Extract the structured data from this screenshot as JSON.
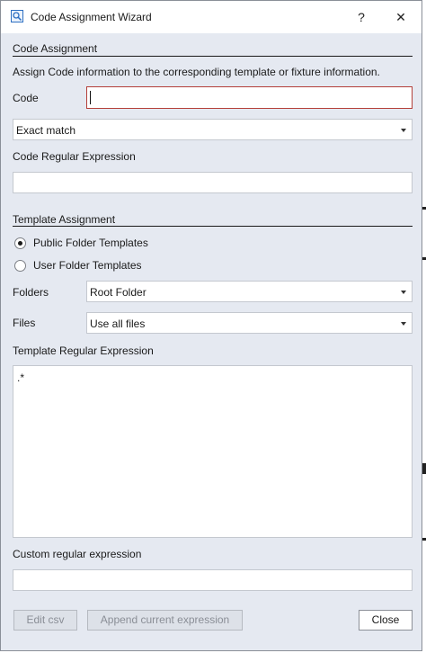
{
  "window": {
    "title": "Code Assignment Wizard",
    "help_label": "?",
    "close_label": "✕"
  },
  "code_assignment": {
    "section_title": "Code Assignment",
    "description": "Assign Code information to the corresponding template or fixture information.",
    "code_label": "Code",
    "code_value": "",
    "match_mode": "Exact match",
    "regex_label": "Code Regular Expression",
    "regex_value": ""
  },
  "template_assignment": {
    "section_title": "Template Assignment",
    "radio_public": "Public Folder Templates",
    "radio_user": "User Folder Templates",
    "selected": "public",
    "folders_label": "Folders",
    "folders_value": "Root Folder",
    "files_label": "Files",
    "files_value": "Use all files",
    "template_regex_label": "Template Regular Expression",
    "template_regex_value": ".*",
    "custom_regex_label": "Custom regular expression",
    "custom_regex_value": ""
  },
  "buttons": {
    "edit_csv": "Edit csv",
    "append_expression": "Append current expression",
    "close": "Close"
  },
  "colors": {
    "dialog_bg": "#e5e9f1",
    "focus_border": "#b4403a",
    "icon_accent": "#2d6fc2"
  },
  "icons": {
    "app": "magnifier-icon",
    "dropdown": "chevron-down-icon"
  }
}
